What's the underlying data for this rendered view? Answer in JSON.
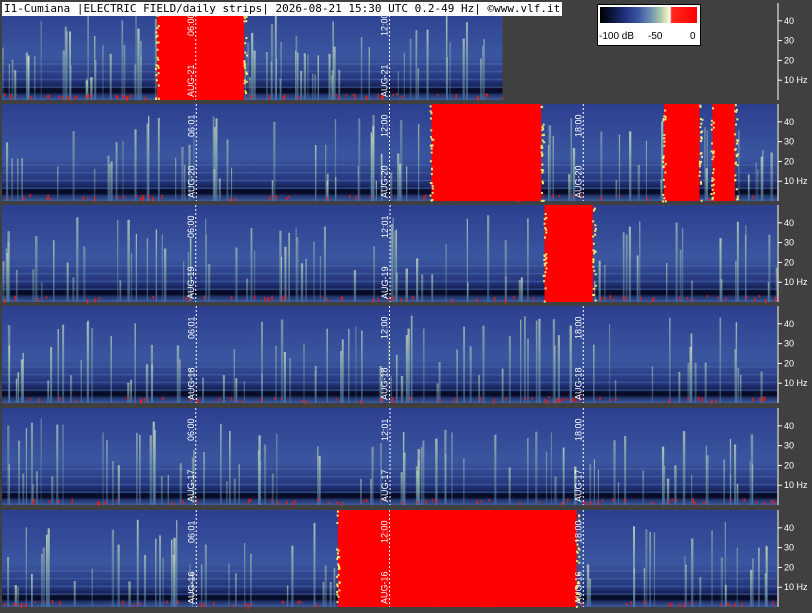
{
  "header": {
    "title": "I1-Cumiana |ELECTRIC FIELD/daily strips| 2026-08-21 15:30 UTC 0.2-49 Hz| ©www.vlf.it"
  },
  "legend": {
    "min_label": "-100 dB",
    "mid_label": "-50",
    "max_label": "0"
  },
  "colors": {
    "background": "#404040",
    "low": "#1a2a6e",
    "mid": "#6f93b5",
    "high": "#c8e0b0",
    "saturated": "#ff0000",
    "divider": "#ffffff"
  },
  "chart_data": {
    "type": "heatmap",
    "title": "I1-Cumiana |ELECTRIC FIELD/daily strips| 2026-08-21 15:30 UTC 0.2-49 Hz| ©www.vlf.it",
    "ylabel_unit": "Hz",
    "y_ticks": [
      "40",
      "30",
      "20",
      "10 Hz"
    ],
    "ylim": [
      0,
      49
    ],
    "colorbar": {
      "ticks": [
        "-100 dB",
        "-50",
        "0"
      ],
      "range_db": [
        -100,
        0
      ]
    },
    "strips": [
      {
        "day": "AUG-21",
        "markers": [
          {
            "date": "AUG-21",
            "time": "06:00"
          },
          {
            "date": "AUG-21",
            "time": "12:00"
          }
        ],
        "data_until_hours": 15.5,
        "saturated_hours": [
          [
            4.8,
            7.5
          ]
        ]
      },
      {
        "day": "AUG-20",
        "markers": [
          {
            "date": "AUG-20",
            "time": "06:01"
          },
          {
            "date": "AUG-20",
            "time": "12:00"
          },
          {
            "date": "AUG-20",
            "time": "18:00"
          }
        ],
        "data_until_hours": 24,
        "saturated_hours": [
          [
            13.3,
            16.7
          ],
          [
            20.5,
            21.6
          ],
          [
            22.0,
            22.7
          ]
        ]
      },
      {
        "day": "AUG-19",
        "markers": [
          {
            "date": "AUG-19",
            "time": "06:00"
          },
          {
            "date": "AUG-19",
            "time": "12:01"
          }
        ],
        "data_until_hours": 24,
        "saturated_hours": [
          [
            16.8,
            18.3
          ]
        ]
      },
      {
        "day": "AUG-18",
        "markers": [
          {
            "date": "AUG-18",
            "time": "06:01"
          },
          {
            "date": "AUG-18",
            "time": "12:00"
          },
          {
            "date": "AUG-18",
            "time": "18:00"
          }
        ],
        "data_until_hours": 24,
        "saturated_hours": []
      },
      {
        "day": "AUG-17",
        "markers": [
          {
            "date": "AUG-17",
            "time": "06:00"
          },
          {
            "date": "AUG-17",
            "time": "12:01"
          },
          {
            "date": "AUG-17",
            "time": "18:00"
          }
        ],
        "data_until_hours": 24,
        "saturated_hours": []
      },
      {
        "day": "AUG-16",
        "markers": [
          {
            "date": "AUG-16",
            "time": "06:01"
          },
          {
            "date": "AUG-16",
            "time": "12:00"
          },
          {
            "date": "AUG-16",
            "time": "18:00"
          }
        ],
        "data_until_hours": 24,
        "saturated_hours": [
          [
            10.4,
            17.8
          ]
        ]
      }
    ]
  }
}
